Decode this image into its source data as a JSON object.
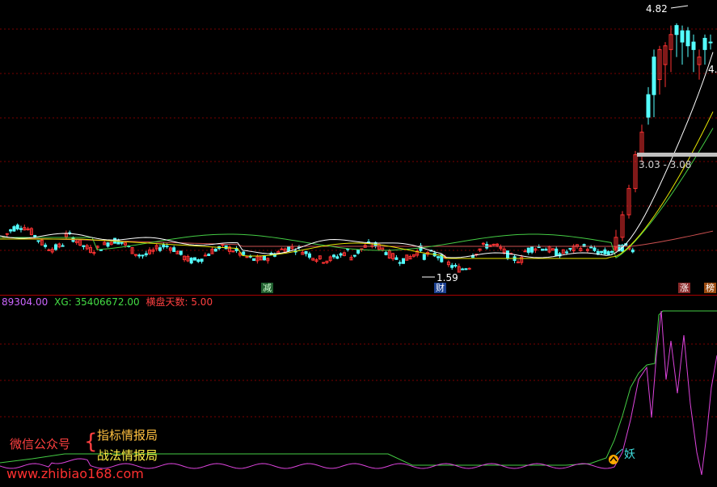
{
  "colors": {
    "grid": "#7a0000",
    "candle_up": "#ff3232",
    "candle_down": "#54ffff",
    "ma_white": "#ffffff",
    "ma_yellow": "#e6e600",
    "ma_green": "#44cc44",
    "ma_pink": "#cc5050",
    "indicator_green": "#44cc44",
    "indicator_magenta": "#dd44dd",
    "highlight_bar": "#c0c0c0"
  },
  "price_panel": {
    "high_marker": "4.82",
    "right_edge_value": "4.",
    "low_marker": "1.59",
    "range_label": "3.03 - 3.08",
    "event_tags": [
      {
        "text": "减",
        "bg": "#1f5e2e",
        "fg": "#d0ffd0"
      },
      {
        "text": "财",
        "bg": "#1a3f8f",
        "fg": "#ffffff"
      },
      {
        "text": "涨",
        "bg": "#8a2a2a",
        "fg": "#ffffff"
      },
      {
        "text": "榜",
        "bg": "#9a4a10",
        "fg": "#ffffff"
      }
    ]
  },
  "indicator_panel": {
    "header": {
      "first_value": "89304.00",
      "xg_label": "XG:",
      "xg_value": "35406672.00",
      "days_label": "横盘天数:",
      "days_value": "5.00"
    },
    "signal_text": "妖"
  },
  "watermark": {
    "wechat": "微信公众号",
    "brace": "{",
    "line1": "指标情报局",
    "line2": "战法情报局",
    "url": "www.zhibiao168.com"
  }
}
